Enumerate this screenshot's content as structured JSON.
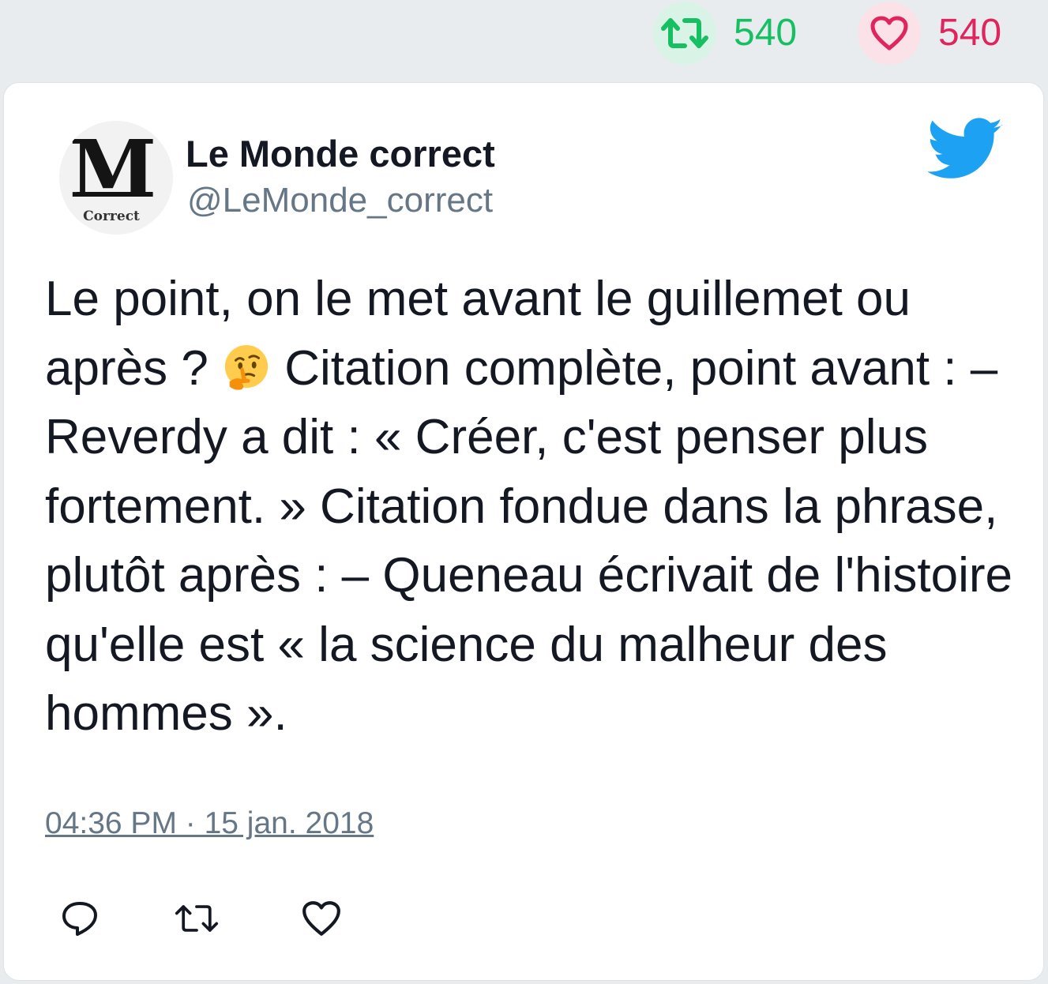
{
  "stats": {
    "retweets": "540",
    "likes": "540",
    "retweet_color": "#17bf63",
    "like_color": "#e0245e"
  },
  "author": {
    "name": "Le Monde correct",
    "handle": "@LeMonde_correct",
    "avatar_letter": "M",
    "avatar_caption": "Correct"
  },
  "tweet": {
    "text_before_emoji": "Le point, on le met avant le guillemet ou après ? ",
    "emoji": "thinking-face",
    "text_after_emoji": " Citation complète, point avant : – Reverdy a dit : « Créer, c'est penser plus fortement. » Citation fondue dans la phrase, plutôt après : – Queneau écrivait de l'histoire qu'elle est « la science du malheur des hommes ».",
    "timestamp": "04:36 PM · 15 jan. 2018"
  },
  "icons": {
    "brand": "twitter-bird-icon",
    "brand_color": "#1da1f2",
    "actions": [
      "reply-icon",
      "retweet-icon",
      "like-icon"
    ]
  }
}
